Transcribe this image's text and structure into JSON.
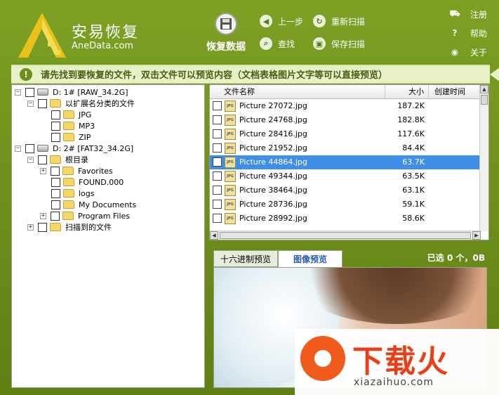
{
  "app": {
    "title": "安易恢复",
    "subtitle": "AneData.com"
  },
  "toolbar": {
    "recover_label": "恢复数据",
    "back_label": "上一步",
    "rescan_label": "重新扫描",
    "find_label": "查找",
    "save_scan_label": "保存扫描",
    "register_label": "注册",
    "help_label": "帮助",
    "about_label": "关于"
  },
  "notice": {
    "text": "请先找到要恢复的文件，双击文件可以预览内容（文档表格图片文字等可以直接预览）"
  },
  "tree": {
    "items": [
      {
        "label": "D:   1# [RAW_34.2G]"
      },
      {
        "label": "以扩展名分类的文件"
      },
      {
        "label": "JPG"
      },
      {
        "label": "MP3"
      },
      {
        "label": "ZIP"
      },
      {
        "label": "D:   2# [FAT32_34.2G]"
      },
      {
        "label": "根目录"
      },
      {
        "label": "Favorites"
      },
      {
        "label": "FOUND.000"
      },
      {
        "label": "logs"
      },
      {
        "label": "My Documents"
      },
      {
        "label": "Program Files"
      },
      {
        "label": "扫描到的文件"
      }
    ]
  },
  "filelist": {
    "columns": {
      "name": "文件名称",
      "size": "大小",
      "created": "创建时间"
    },
    "rows": [
      {
        "name": "Picture 27072.jpg",
        "size": "187.2K"
      },
      {
        "name": "Picture 24768.jpg",
        "size": "182.8K"
      },
      {
        "name": "Picture 28416.jpg",
        "size": "117.6K"
      },
      {
        "name": "Picture 21952.jpg",
        "size": "84.4K"
      },
      {
        "name": "Picture 44864.jpg",
        "size": "63.7K"
      },
      {
        "name": "Picture 49344.jpg",
        "size": "63.5K"
      },
      {
        "name": "Picture 38464.jpg",
        "size": "63.1K"
      },
      {
        "name": "Picture 28736.jpg",
        "size": "59.1K"
      },
      {
        "name": "Picture 28992.jpg",
        "size": "58.6K"
      }
    ],
    "selected_index": 4
  },
  "preview": {
    "tab_hex": "十六进制预览",
    "tab_image": "图像预览",
    "selected_count": "已选 0 个，0B"
  },
  "watermark": {
    "text": "下载火",
    "sub": "xiazaihuo.com"
  }
}
